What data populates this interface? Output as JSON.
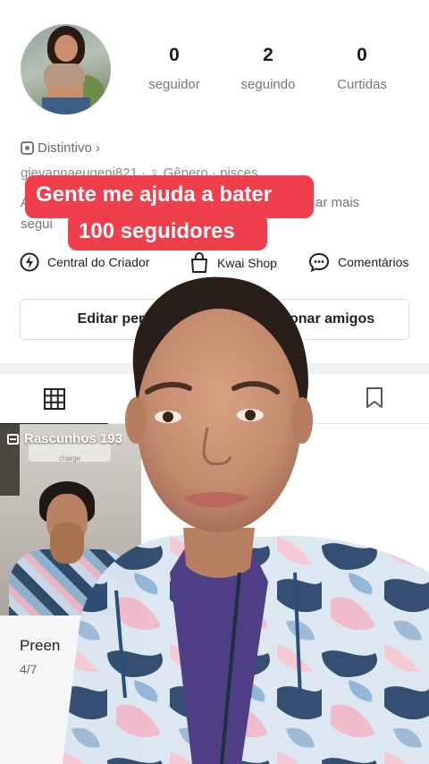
{
  "profile": {
    "stats": [
      {
        "value": "0",
        "label": "seguidor"
      },
      {
        "value": "2",
        "label": "seguindo"
      },
      {
        "value": "0",
        "label": "Curtidas"
      }
    ],
    "badge_label": "Distintivo",
    "badge_chevron": "›",
    "meta_line": "gievannaeugeni821 · ♀ Gênero · pisces",
    "bio_line1_start": "A",
    "bio_line1_end": "ar mais",
    "bio_line2": "segui"
  },
  "caption": {
    "line1": "Gente me ajuda a bater",
    "line2": "100 seguidores"
  },
  "tools": [
    {
      "icon": "lightning-icon",
      "label": "Central do Criador"
    },
    {
      "icon": "shopping-bag-icon",
      "label": "Kwai Shop"
    },
    {
      "icon": "comment-icon",
      "label": "Comentários"
    }
  ],
  "buttons": {
    "edit_profile": "Editar perfil",
    "add_friends": "Adicionar amigos"
  },
  "drafts": {
    "label": "Rascunhos 193",
    "screen_text": "charge",
    "title": "Preen",
    "date": "4/7"
  },
  "colors": {
    "caption_bg": "#ef3e4c",
    "caption_text": "#ffffff",
    "text_primary": "#222222",
    "text_secondary": "#777777"
  }
}
